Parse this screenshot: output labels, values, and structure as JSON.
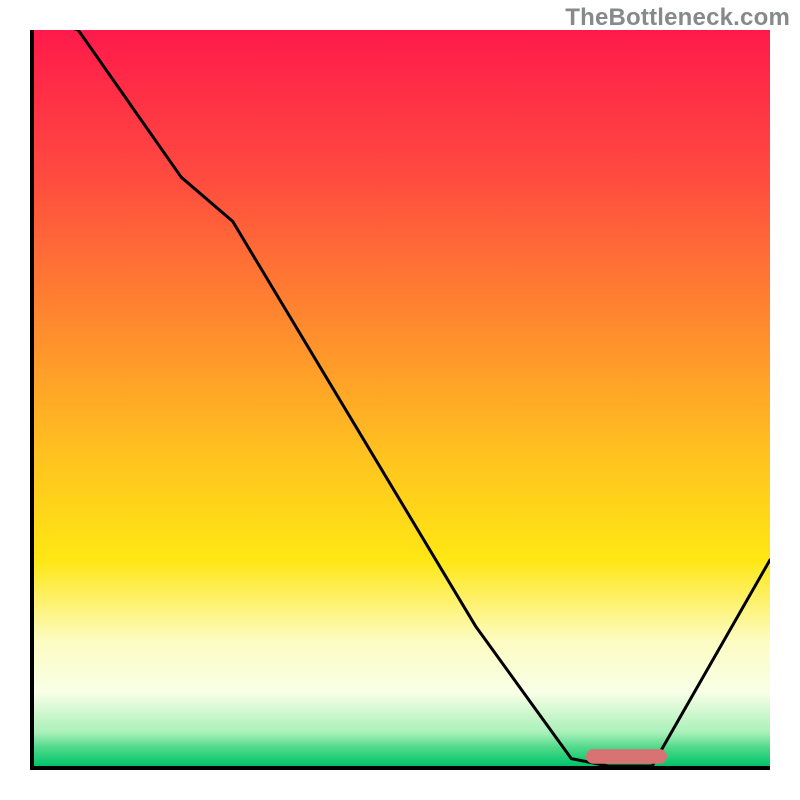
{
  "watermark": "TheBottleneck.com",
  "chart_data": {
    "type": "line",
    "title": "",
    "xlabel": "",
    "ylabel": "",
    "xlim": [
      0,
      100
    ],
    "ylim": [
      0,
      100
    ],
    "grid": false,
    "legend": false,
    "gradient_stops": [
      {
        "offset": 0.0,
        "color": "#ff1a4b"
      },
      {
        "offset": 0.2,
        "color": "#ff4b3f"
      },
      {
        "offset": 0.4,
        "color": "#ff8a2e"
      },
      {
        "offset": 0.58,
        "color": "#ffc31f"
      },
      {
        "offset": 0.72,
        "color": "#ffe714"
      },
      {
        "offset": 0.83,
        "color": "#fdfcc2"
      },
      {
        "offset": 0.9,
        "color": "#f8ffe6"
      },
      {
        "offset": 0.955,
        "color": "#a8f0b8"
      },
      {
        "offset": 0.975,
        "color": "#4fd98a"
      },
      {
        "offset": 1.0,
        "color": "#00c46a"
      }
    ],
    "series": [
      {
        "name": "bottleneck-curve",
        "x": [
          0,
          6,
          20,
          27,
          60,
          73,
          78,
          84,
          100
        ],
        "values": [
          102,
          100,
          80,
          74,
          19,
          1,
          0,
          0,
          28
        ]
      }
    ],
    "marker": {
      "name": "optimal-range",
      "x_start": 76,
      "x_end": 85,
      "y": 1.3,
      "color": "#d87373",
      "thickness": 2.0
    }
  }
}
